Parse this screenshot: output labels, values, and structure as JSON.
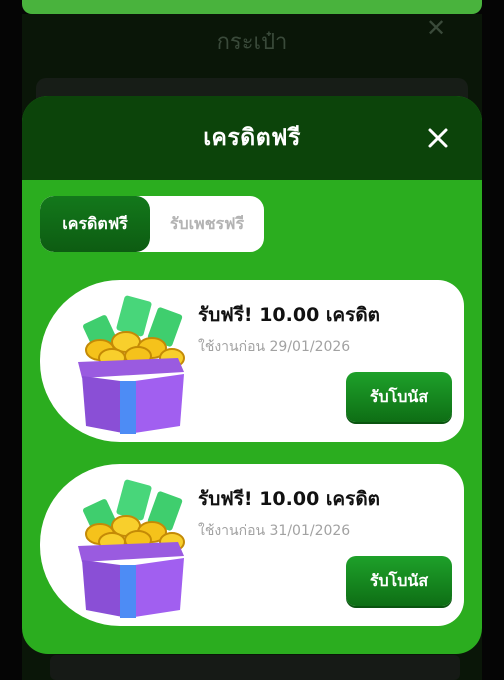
{
  "background": {
    "title": "กระเป๋า",
    "close_symbol": "✕"
  },
  "modal": {
    "title": "เครดิตฟรี",
    "close_icon": "close-icon"
  },
  "tabs": [
    {
      "label": "เครดิตฟรี",
      "active": true
    },
    {
      "label": "รับเพชรฟรี",
      "active": false
    }
  ],
  "offers": [
    {
      "title": "รับฟรี! 10.00 เครดิต",
      "expiry": "ใช้งานก่อน 29/01/2026",
      "button": "รับโบนัส",
      "icon": "gift-box-icon"
    },
    {
      "title": "รับฟรี! 10.00 เครดิต",
      "expiry": "ใช้งานก่อน 31/01/2026",
      "button": "รับโบนัส",
      "icon": "gift-box-icon"
    }
  ],
  "colors": {
    "panel_green": "#2bad1f",
    "header_dark_green": "#0c440a",
    "button_green": "#1ea12a"
  }
}
